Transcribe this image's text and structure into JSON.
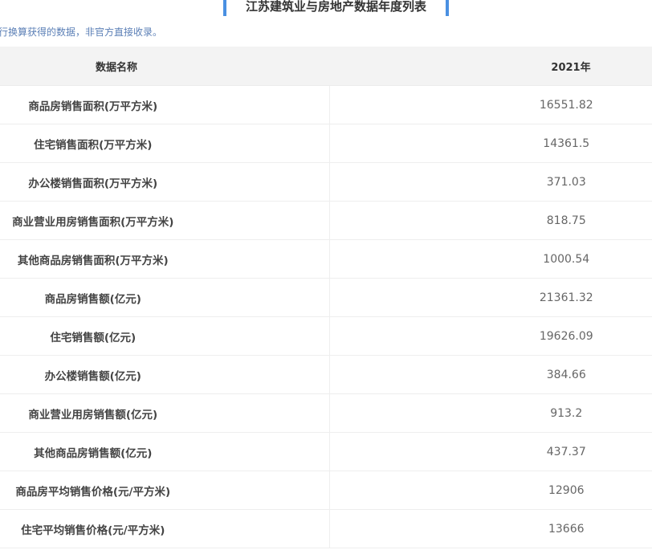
{
  "title": "江苏建筑业与房地产数据年度列表",
  "note": "行换算获得的数据，非官方直接收录。",
  "table": {
    "headers": [
      "数据名称",
      "2021年"
    ],
    "rows": [
      {
        "name": "商品房销售面积(万平方米)",
        "value": "16551.82"
      },
      {
        "name": "住宅销售面积(万平方米)",
        "value": "14361.5"
      },
      {
        "name": "办公楼销售面积(万平方米)",
        "value": "371.03"
      },
      {
        "name": "商业营业用房销售面积(万平方米)",
        "value": "818.75"
      },
      {
        "name": "其他商品房销售面积(万平方米)",
        "value": "1000.54"
      },
      {
        "name": "商品房销售额(亿元)",
        "value": "21361.32"
      },
      {
        "name": "住宅销售额(亿元)",
        "value": "19626.09"
      },
      {
        "name": "办公楼销售额(亿元)",
        "value": "384.66"
      },
      {
        "name": "商业营业用房销售额(亿元)",
        "value": "913.2"
      },
      {
        "name": "其他商品房销售额(亿元)",
        "value": "437.37"
      },
      {
        "name": "商品房平均销售价格(元/平方米)",
        "value": "12906"
      },
      {
        "name": "住宅平均销售价格(元/平方米)",
        "value": "13666"
      }
    ]
  },
  "colors": {
    "accent": "#4a90e2",
    "header_bg": "#f3f3f3",
    "note": "#5b7fb6"
  }
}
